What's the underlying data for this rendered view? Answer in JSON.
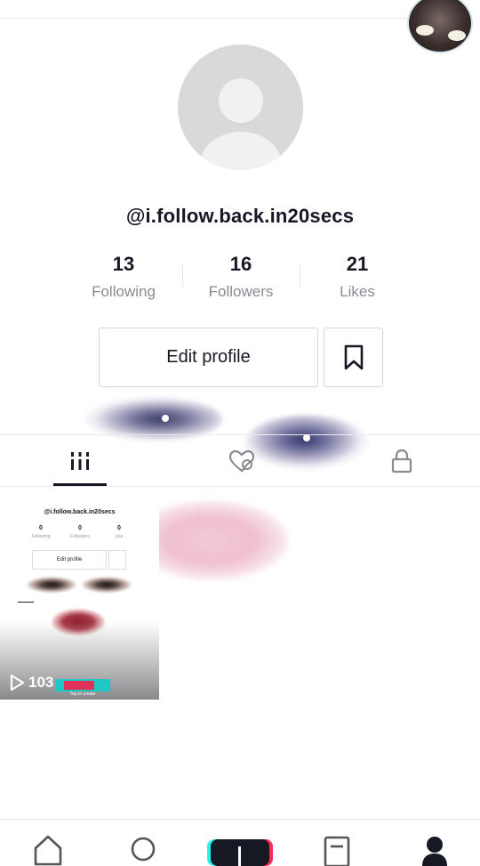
{
  "profile": {
    "username": "@i.follow.back.in20secs",
    "stats": [
      {
        "value": "13",
        "label": "Following"
      },
      {
        "value": "16",
        "label": "Followers"
      },
      {
        "value": "21",
        "label": "Likes"
      }
    ],
    "edit_label": "Edit profile"
  },
  "tabs": [
    {
      "icon": "grid-icon",
      "active": true
    },
    {
      "icon": "liked-hidden-icon",
      "active": false
    },
    {
      "icon": "lock-icon",
      "active": false
    }
  ],
  "video": {
    "views": "103",
    "thumb_username": "@i.follow.back.in20secs",
    "thumb_stats": [
      {
        "value": "0",
        "label": "Following"
      },
      {
        "value": "0",
        "label": "Followers"
      },
      {
        "value": "0",
        "label": "Like"
      }
    ],
    "thumb_edit_label": "Edit profile",
    "thumb_tap_label": "Tap to create"
  },
  "nav": [
    "home-icon",
    "discover-icon",
    "create-icon",
    "inbox-icon",
    "me-icon"
  ],
  "colors": {
    "text": "#161823",
    "muted": "#8a8b91",
    "accent_cyan": "#25f4ee",
    "accent_red": "#fe2c55"
  }
}
